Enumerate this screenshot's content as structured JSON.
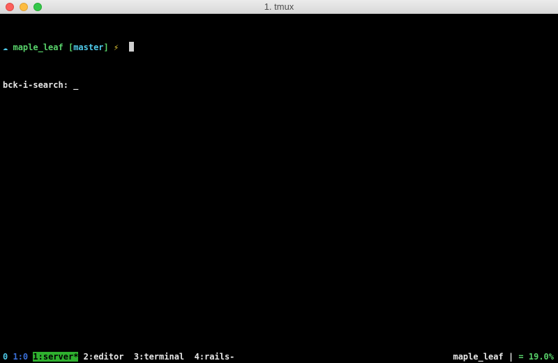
{
  "window": {
    "title": "1. tmux"
  },
  "prompt": {
    "icon": "cloud-icon",
    "glyph": "☁",
    "directory": "maple_leaf",
    "bracket_open": "[",
    "branch": "master",
    "bracket_close": "]",
    "bolt": "⚡"
  },
  "search": {
    "label": "bck-i-search: _"
  },
  "status": {
    "session": "0",
    "pane": "1:0",
    "windows": [
      {
        "label": "1:server*",
        "active": true
      },
      {
        "label": "2:editor",
        "active": false
      },
      {
        "label": "3:terminal",
        "active": false
      },
      {
        "label": "4:rails-",
        "active": false
      }
    ],
    "hostname": "maple_leaf",
    "separator": "|",
    "battery": "= 19.0%"
  }
}
